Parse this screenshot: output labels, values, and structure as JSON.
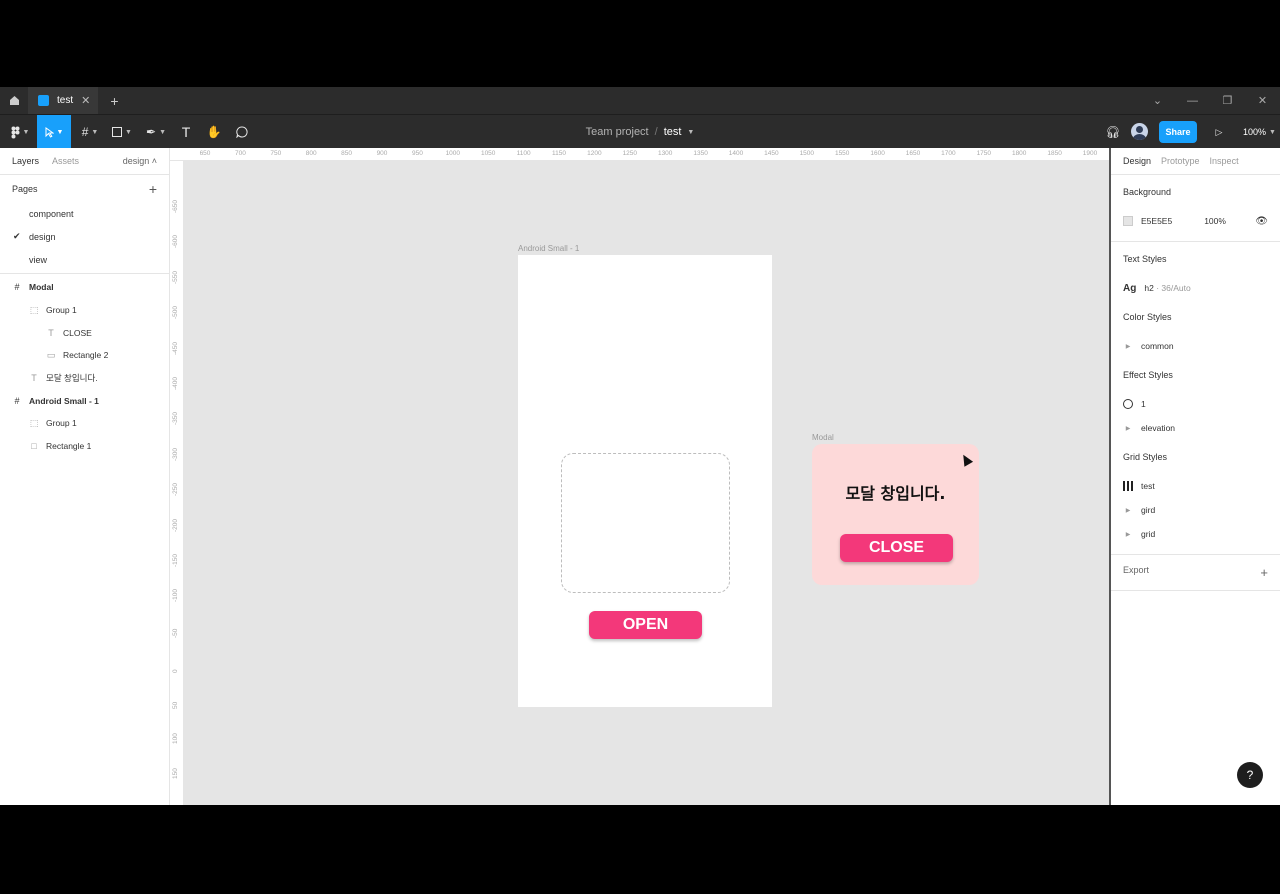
{
  "tabs": [
    {
      "label": "test"
    }
  ],
  "toolbar": {
    "project": "Team project",
    "separator": "/",
    "file_name": "test",
    "share_label": "Share",
    "zoom": "100%"
  },
  "left_panel": {
    "tab_layers": "Layers",
    "tab_assets": "Assets",
    "page_selector": "design",
    "pages_title": "Pages",
    "pages": [
      {
        "label": "component"
      },
      {
        "label": "design",
        "selected": true
      },
      {
        "label": "view"
      }
    ],
    "layers": [
      {
        "label": "Modal",
        "indent": 0,
        "type": "frame"
      },
      {
        "label": "Group 1",
        "indent": 1,
        "type": "group"
      },
      {
        "label": "CLOSE",
        "indent": 2,
        "type": "text"
      },
      {
        "label": "Rectangle 2",
        "indent": 2,
        "type": "rectangle"
      },
      {
        "label": "모달 창입니다.",
        "indent": 1,
        "type": "text"
      },
      {
        "label": "Android Small - 1",
        "indent": 0,
        "type": "frame"
      },
      {
        "label": "Group 1",
        "indent": 1,
        "type": "group"
      },
      {
        "label": "Rectangle 1",
        "indent": 1,
        "type": "rectangle"
      }
    ]
  },
  "rulers": {
    "top": [
      "650",
      "700",
      "750",
      "800",
      "850",
      "900",
      "950",
      "1000",
      "1050",
      "1100",
      "1150",
      "1200",
      "1250",
      "1300",
      "1350",
      "1400",
      "1450",
      "1500",
      "1550",
      "1600",
      "1650",
      "1700",
      "1750",
      "1800",
      "1850",
      "1900"
    ],
    "left": [
      "-650",
      "-600",
      "-550",
      "-500",
      "-450",
      "-400",
      "-350",
      "-300",
      "-250",
      "-200",
      "-150",
      "-100",
      "-50",
      "0",
      "50",
      "100",
      "150"
    ]
  },
  "canvas": {
    "android_frame_label": "Android Small - 1",
    "open_label": "OPEN",
    "modal_frame_label": "Modal",
    "modal_text": "모달 창입니다.",
    "close_label": "CLOSE"
  },
  "right_panel": {
    "tab_design": "Design",
    "tab_prototype": "Prototype",
    "tab_inspect": "Inspect",
    "background_title": "Background",
    "background_hex": "E5E5E5",
    "background_opacity": "100%",
    "text_styles_title": "Text Styles",
    "text_style_icon": "Ag",
    "text_style_name": "h2",
    "text_style_meta": "· 36/Auto",
    "color_styles_title": "Color Styles",
    "color_style_common": "common",
    "effect_styles_title": "Effect Styles",
    "effect_style_1": "1",
    "effect_style_elevation": "elevation",
    "grid_styles_title": "Grid Styles",
    "grid_style_test": "test",
    "grid_style_gird": "gird",
    "grid_style_grid": "grid",
    "export_label": "Export"
  },
  "colors": {
    "accent": "#18a0fb",
    "button_pink": "#f3387a",
    "modal_bg": "#fdd9d9",
    "canvas_bg": "#e5e5e5"
  },
  "help_label": "?"
}
